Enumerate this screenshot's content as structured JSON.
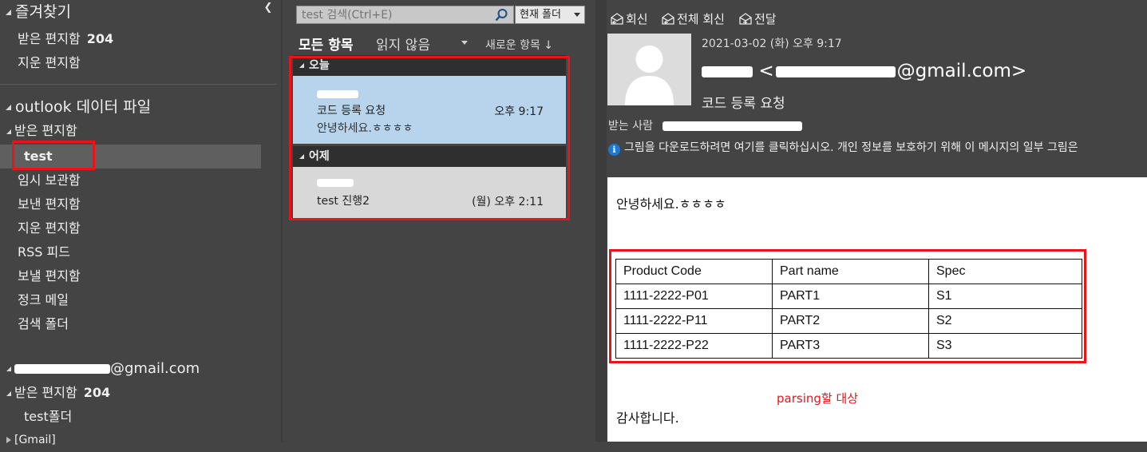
{
  "sidebar": {
    "favorites_header": "즐겨찾기",
    "favorites": [
      {
        "label": "받은 편지함",
        "count": "204"
      },
      {
        "label": "지운 편지함",
        "count": ""
      }
    ],
    "datafile_header": "outlook 데이터 파일",
    "datafile_inbox": "받은 편지함",
    "datafile_folders": [
      {
        "label": "test"
      },
      {
        "label": "임시 보관함"
      },
      {
        "label": "보낸 편지함"
      },
      {
        "label": "지운 편지함"
      },
      {
        "label": "RSS 피드"
      },
      {
        "label": "보낼 편지함"
      },
      {
        "label": "정크 메일"
      },
      {
        "label": "검색 폴더"
      }
    ],
    "account_suffix": "@gmail.com",
    "account_inbox": {
      "label": "받은 편지함",
      "count": "204"
    },
    "account_subfolder": "test폴더",
    "gmail_folder": "[Gmail]"
  },
  "messagelist": {
    "search_placeholder": "test 검색(Ctrl+E)",
    "search_scope": "현재 폴더",
    "filter_all": "모든 항목",
    "filter_unread": "읽지 않음",
    "sort_label": "새로운 항목 ↓",
    "groups": [
      {
        "header": "오늘",
        "message": {
          "subject": "코드 등록 요청",
          "time": "오후 9:17",
          "preview": "안녕하세요.ㅎㅎㅎㅎ"
        }
      },
      {
        "header": "어제",
        "message": {
          "subject": "test 진행2",
          "time": "(월) 오후 2:11",
          "preview": ""
        }
      }
    ]
  },
  "reading": {
    "actions": {
      "reply": "회신",
      "reply_all": "전체 회신",
      "forward": "전달"
    },
    "date": "2021-03-02 (화) 오후 9:17",
    "from_prefix": "<",
    "from_suffix": "@gmail.com>",
    "subject": "코드 등록 요청",
    "to_label": "받는 사람",
    "info_text": "그림을 다운로드하려면 여기를 클릭하십시오. 개인 정보를 보호하기 위해 이 메시지의 일부 그림은",
    "body": {
      "greeting": "안녕하세요.ㅎㅎㅎㅎ",
      "table": {
        "headers": [
          "Product Code",
          "Part name",
          "Spec"
        ],
        "rows": [
          [
            "1111-2222-P01",
            "PART1",
            "S1"
          ],
          [
            "1111-2222-P11",
            "PART2",
            "S2"
          ],
          [
            "1111-2222-P22",
            "PART3",
            "S3"
          ]
        ]
      },
      "note": "parsing할 대상",
      "closing": "감사합니다."
    }
  },
  "colors": {
    "accent_red": "#e8141c",
    "selected_blue": "#b8d4ec",
    "info_blue": "#1e78d2"
  }
}
